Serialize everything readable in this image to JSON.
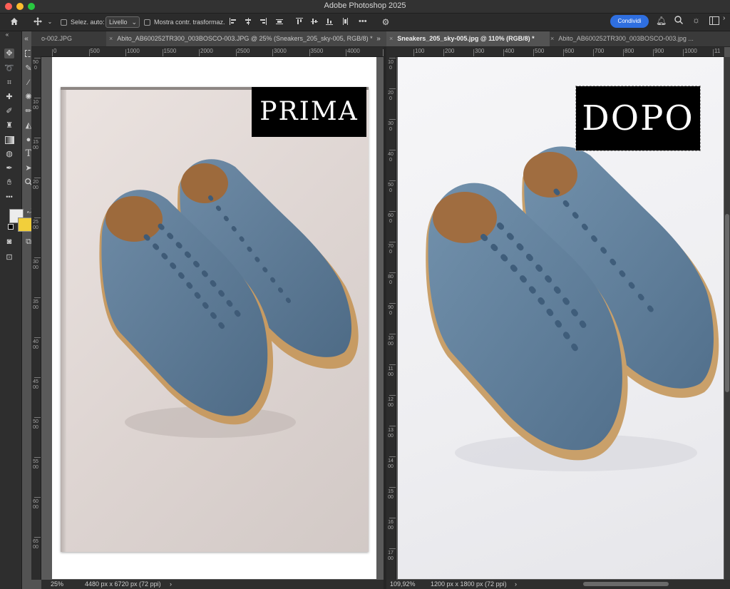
{
  "app": {
    "title": "Adobe Photoshop 2025"
  },
  "options_bar": {
    "auto_select_label": "Selez. auto:",
    "layer_select_value": "Livello",
    "transform_controls_label": "Mostra contr. trasformaz.",
    "more_label": "•••",
    "share_label": "Condividi"
  },
  "left_pane": {
    "tabs": [
      {
        "label": "o-002.JPG",
        "active": false
      },
      {
        "label": "Abito_AB600252TR300_003BOSCO-003.JPG @ 25% (Sneakers_205_sky-005, RGB/8) *",
        "active": true
      }
    ],
    "ruler_labels": [
      "0",
      "500",
      "1000",
      "1500",
      "2000",
      "2500",
      "3000",
      "3500",
      "4000",
      "450"
    ],
    "vruler_labels": [
      "500",
      "1000",
      "1500",
      "2000",
      "2500",
      "3000",
      "3500",
      "4000",
      "4500",
      "5000",
      "5500",
      "6000",
      "6500"
    ],
    "stamp_text": "PRIMA",
    "zoom": "25%",
    "doc_info": "4480 px x 6720 px (72 ppi)"
  },
  "right_pane": {
    "tabs": [
      {
        "label": "Sneakers_205_sky-005.jpg @ 110% (RGB/8) *",
        "active": true
      },
      {
        "label": "Abito_AB600252TR300_003BOSCO-003.jpg ...",
        "active": false
      }
    ],
    "ruler_labels": [
      "100",
      "200",
      "300",
      "400",
      "500",
      "600",
      "700",
      "800",
      "900",
      "1000",
      "11"
    ],
    "vruler_labels": [
      "100",
      "200",
      "300",
      "400",
      "500",
      "600",
      "700",
      "800",
      "900",
      "1000",
      "1100",
      "1200",
      "1300",
      "1400",
      "1500",
      "1600",
      "1700"
    ],
    "stamp_text": "DOPO",
    "zoom": "109,92%",
    "doc_info": "1200 px x 1800 px (72 ppi)"
  },
  "colors": {
    "foreground": "#ececec",
    "background": "#f2cf3b",
    "share_button": "#2f6fe0"
  }
}
